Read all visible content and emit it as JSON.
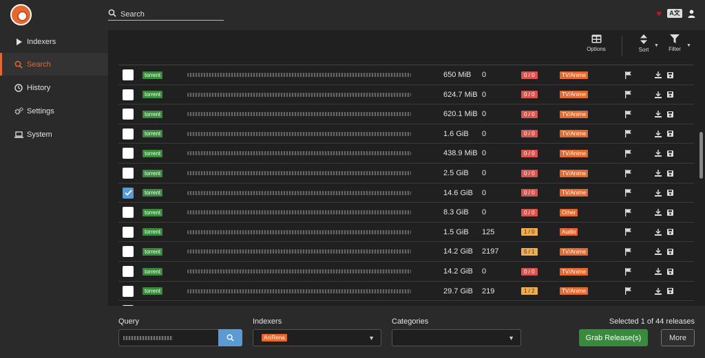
{
  "header": {
    "search_placeholder": "Search",
    "icons": [
      "logo-icon",
      "search-icon",
      "heart-icon",
      "translate-icon",
      "user-icon"
    ]
  },
  "sidebar": {
    "items": [
      {
        "label": "Indexers",
        "icon": "play-icon"
      },
      {
        "label": "Search",
        "icon": "search-icon",
        "active": true
      },
      {
        "label": "History",
        "icon": "clock-icon"
      },
      {
        "label": "Settings",
        "icon": "cogs-icon"
      },
      {
        "label": "System",
        "icon": "laptop-icon"
      }
    ]
  },
  "toolbar": {
    "options_label": "Options",
    "sort_label": "Sort",
    "filter_label": "Filter"
  },
  "results": [
    {
      "checked": false,
      "protocol": "torrent",
      "size": "650 MiB",
      "grabs": "0",
      "peers": "0 / 0",
      "peers_color": "red",
      "category": "TV/Anime"
    },
    {
      "checked": false,
      "protocol": "torrent",
      "size": "624.7 MiB",
      "grabs": "0",
      "peers": "0 / 0",
      "peers_color": "red",
      "category": "TV/Anime"
    },
    {
      "checked": false,
      "protocol": "torrent",
      "size": "620.1 MiB",
      "grabs": "0",
      "peers": "0 / 0",
      "peers_color": "red",
      "category": "TV/Anime"
    },
    {
      "checked": false,
      "protocol": "torrent",
      "size": "1.6 GiB",
      "grabs": "0",
      "peers": "0 / 0",
      "peers_color": "red",
      "category": "TV/Anime"
    },
    {
      "checked": false,
      "protocol": "torrent",
      "size": "438.9 MiB",
      "grabs": "0",
      "peers": "0 / 0",
      "peers_color": "red",
      "category": "TV/Anime"
    },
    {
      "checked": false,
      "protocol": "torrent",
      "size": "2.5 GiB",
      "grabs": "0",
      "peers": "0 / 0",
      "peers_color": "red",
      "category": "TV/Anime"
    },
    {
      "checked": true,
      "protocol": "torrent",
      "size": "14.6 GiB",
      "grabs": "0",
      "peers": "0 / 0",
      "peers_color": "red",
      "category": "TV/Anime"
    },
    {
      "checked": false,
      "protocol": "torrent",
      "size": "8.3 GiB",
      "grabs": "0",
      "peers": "0 / 0",
      "peers_color": "red",
      "category": "Other"
    },
    {
      "checked": false,
      "protocol": "torrent",
      "size": "1.5 GiB",
      "grabs": "125",
      "peers": "1 / 0",
      "peers_color": "orange",
      "category": "Audio"
    },
    {
      "checked": false,
      "protocol": "torrent",
      "size": "14.2 GiB",
      "grabs": "2197",
      "peers": "5 / 1",
      "peers_color": "orange",
      "category": "TV/Anime"
    },
    {
      "checked": false,
      "protocol": "torrent",
      "size": "14.2 GiB",
      "grabs": "0",
      "peers": "0 / 0",
      "peers_color": "red",
      "category": "TV/Anime"
    },
    {
      "checked": false,
      "protocol": "torrent",
      "size": "29.7 GiB",
      "grabs": "219",
      "peers": "1 / 2",
      "peers_color": "orange",
      "category": "TV/Anime"
    }
  ],
  "row_action_icons": [
    "flag-icon",
    "download-icon",
    "save-icon"
  ],
  "footer": {
    "query_label": "Query",
    "indexers_label": "Indexers",
    "indexers_value": "AniRena",
    "categories_label": "Categories",
    "selected_text": "Selected 1 of 44 releases",
    "grab_button": "Grab Release(s)",
    "more_button": "More"
  },
  "colors": {
    "accent": "#e5692f",
    "torrent_tag": "#3a8a3d",
    "peers_red": "#d9534f",
    "peers_orange": "#f0ad4e",
    "primary_blue": "#5b9bd5"
  }
}
